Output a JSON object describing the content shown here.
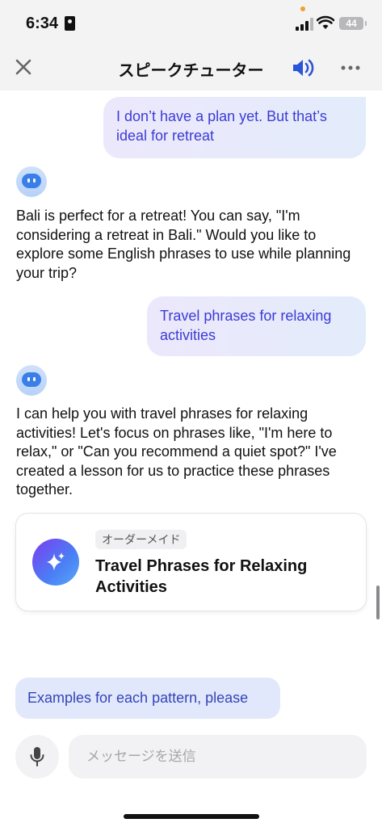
{
  "status_bar": {
    "time": "6:34",
    "battery": "44",
    "icons": [
      "lock-icon",
      "signal-icon",
      "wifi-icon",
      "battery-icon"
    ]
  },
  "header": {
    "title": "スピークチューター",
    "icons": [
      "close-icon",
      "speaker-icon",
      "more-icon"
    ],
    "accent_color": "#2a55d9"
  },
  "messages": [
    {
      "role": "user",
      "text": "I don’t have a plan yet. But that’s ideal for retreat"
    },
    {
      "role": "bot",
      "text": "Bali is perfect for a retreat! You can say, \"I'm considering a retreat in Bali.\" Would you like to explore some English phrases to use while planning your trip?"
    },
    {
      "role": "user",
      "text": "Travel phrases for relaxing activities"
    },
    {
      "role": "bot",
      "text": "I can help you with travel phrases for relaxing activities! Let's focus on phrases like, \"I'm here to relax,\" or \"Can you recommend a quiet spot?\" I've created a lesson for us to practice these phrases together."
    }
  ],
  "lesson_card": {
    "badge": "オーダーメイド",
    "title": "Travel Phrases for Relaxing Activities",
    "icon": "sparkle-icon"
  },
  "suggestion": {
    "label": "Examples for each pattern, please"
  },
  "composer": {
    "placeholder": "メッセージを送信",
    "value": "",
    "icon": "mic-icon"
  },
  "colors": {
    "user_bubble_text": "#3b3bd6",
    "suggestion_bg": "#e2e8fb",
    "suggestion_text": "#3344b8"
  }
}
